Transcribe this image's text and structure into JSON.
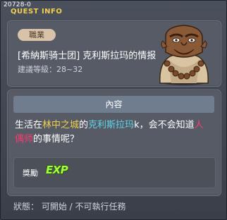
{
  "window": {
    "quest_id": "20728-0",
    "title": "QUEST INFO"
  },
  "header": {
    "job_badge": "職業",
    "quest_name": "[希納斯骑士团] 克利斯拉玛的情报",
    "level_label": "建議等級",
    "level_sep": "：",
    "level_value": "28~32",
    "npc_icon": "npc-old-monk-portrait"
  },
  "content": {
    "section_title": "內容",
    "desc_part1": "生活在",
    "desc_town": "林中之城",
    "desc_part2": "的",
    "desc_npc": "克利斯拉玛",
    "desc_part3": "k，会不会知道",
    "desc_puppet": "人偶师",
    "desc_part4": "的事情呢？",
    "highlight_colors": {
      "town": "#f0d046",
      "npc": "#5fd5e6",
      "puppet": "#ff3a6e"
    }
  },
  "reward": {
    "label": "獎勵",
    "exp": "EXP"
  },
  "status": {
    "text": "狀態： 可開始 / 不可執行任務"
  }
}
